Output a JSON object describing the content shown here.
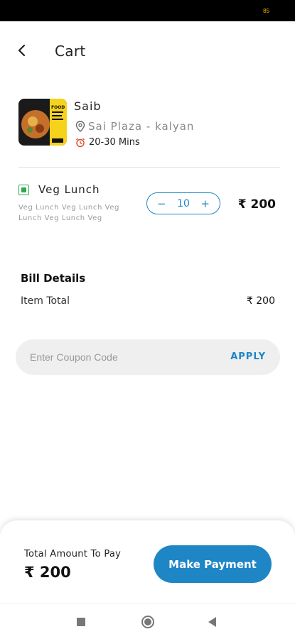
{
  "status_bar": {
    "battery": "85"
  },
  "header": {
    "title": "Cart",
    "back_icon": "arrow-left-icon"
  },
  "restaurant": {
    "name": "Saib",
    "location": "Sai Plaza - kalyan",
    "delivery_time": "20-30 Mins",
    "location_icon": "location-pin-icon",
    "time_icon": "alarm-clock-icon",
    "thumbnail_text": "FOOD"
  },
  "cart_item": {
    "name": "Veg Lunch",
    "description": "Veg Lunch Veg Lunch Veg Lunch Veg Lunch Veg",
    "quantity": "10",
    "minus_label": "−",
    "plus_label": "+",
    "price": "₹ 200",
    "veg_color": "#2eaa4e"
  },
  "bill": {
    "title": "Bill Details",
    "item_total_label": "Item Total",
    "item_total_value": "₹ 200"
  },
  "coupon": {
    "placeholder": "Enter Coupon Code",
    "value": "",
    "apply_label": "APPLY"
  },
  "footer": {
    "total_label": "Total Amount To Pay",
    "total_amount": "₹ 200",
    "pay_button_label": "Make Payment"
  },
  "colors": {
    "accent": "#1f86c6",
    "veg": "#2eaa4e"
  }
}
